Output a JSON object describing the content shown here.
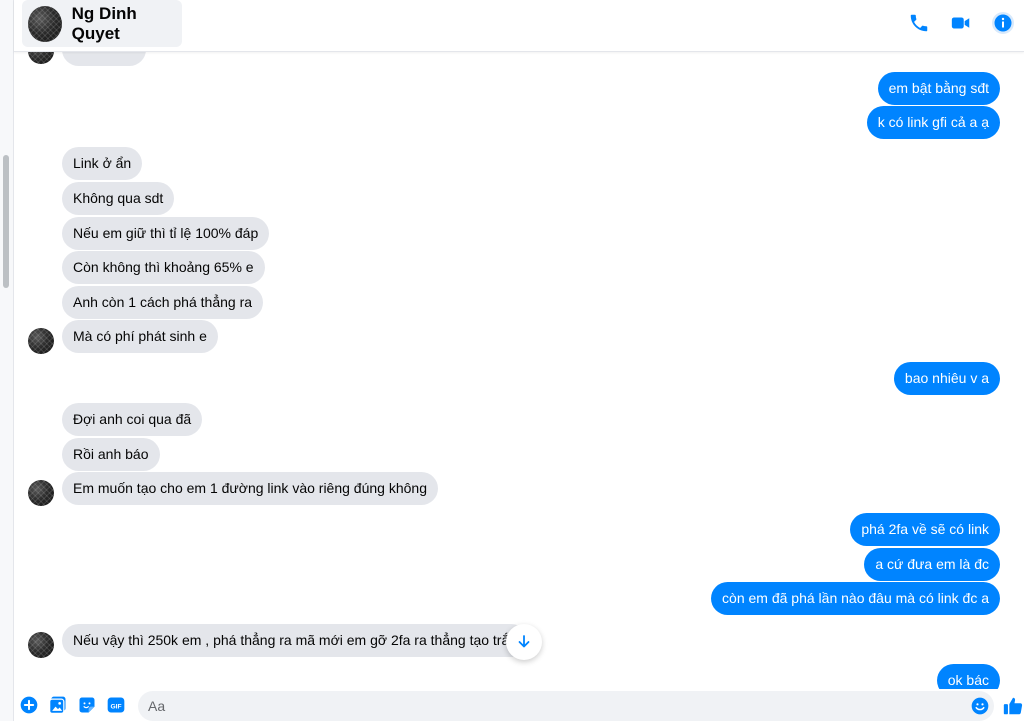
{
  "header": {
    "contact_name": "Ng Dinh Quyet"
  },
  "colors": {
    "accent": "#0084ff",
    "incoming_bubble": "#e4e6eb",
    "outgoing_bubble": "#0084ff"
  },
  "messages": [
    {
      "dir": "in",
      "text": ""
    },
    {
      "dir": "out",
      "text": "em bật bằng sđt"
    },
    {
      "dir": "out",
      "text": "k có link gfi cả a ạ"
    },
    {
      "dir": "in",
      "text": "Link ở ẩn"
    },
    {
      "dir": "in",
      "text": "Không qua sdt"
    },
    {
      "dir": "in",
      "text": "Nếu em giữ thì tỉ lệ 100% đáp"
    },
    {
      "dir": "in",
      "text": "Còn không thì khoảng 65% e"
    },
    {
      "dir": "in",
      "text": "Anh còn 1 cách phá thẳng ra"
    },
    {
      "dir": "in",
      "text": "Mà có phí phát sinh e"
    },
    {
      "dir": "out",
      "text": "bao nhiêu v a"
    },
    {
      "dir": "in",
      "text": "Đợi anh coi qua đã"
    },
    {
      "dir": "in",
      "text": "Rồi anh báo"
    },
    {
      "dir": "in",
      "text": "Em muốn tạo cho em 1 đường link vào riêng đúng không"
    },
    {
      "dir": "out",
      "text": "phá 2fa về sẽ có link"
    },
    {
      "dir": "out",
      "text": "a cứ đưa em là đc"
    },
    {
      "dir": "out",
      "text": "còn em đã phá lần nào đâu mà có link đc a"
    },
    {
      "dir": "in",
      "text": "Nếu vậy thì 250k em , phá thẳng ra mã mới em gỡ 2fa ra thẳng tạo trắng"
    },
    {
      "dir": "out",
      "text": "ok bác"
    }
  ],
  "composer": {
    "placeholder": "Aa",
    "icons": [
      "plus-icon",
      "image-icon",
      "sticker-icon",
      "gif-icon",
      "emoji-icon",
      "thumbs-up-icon"
    ],
    "gif_label": "GIF"
  },
  "header_icons": [
    "phone-icon",
    "video-icon",
    "info-icon"
  ]
}
